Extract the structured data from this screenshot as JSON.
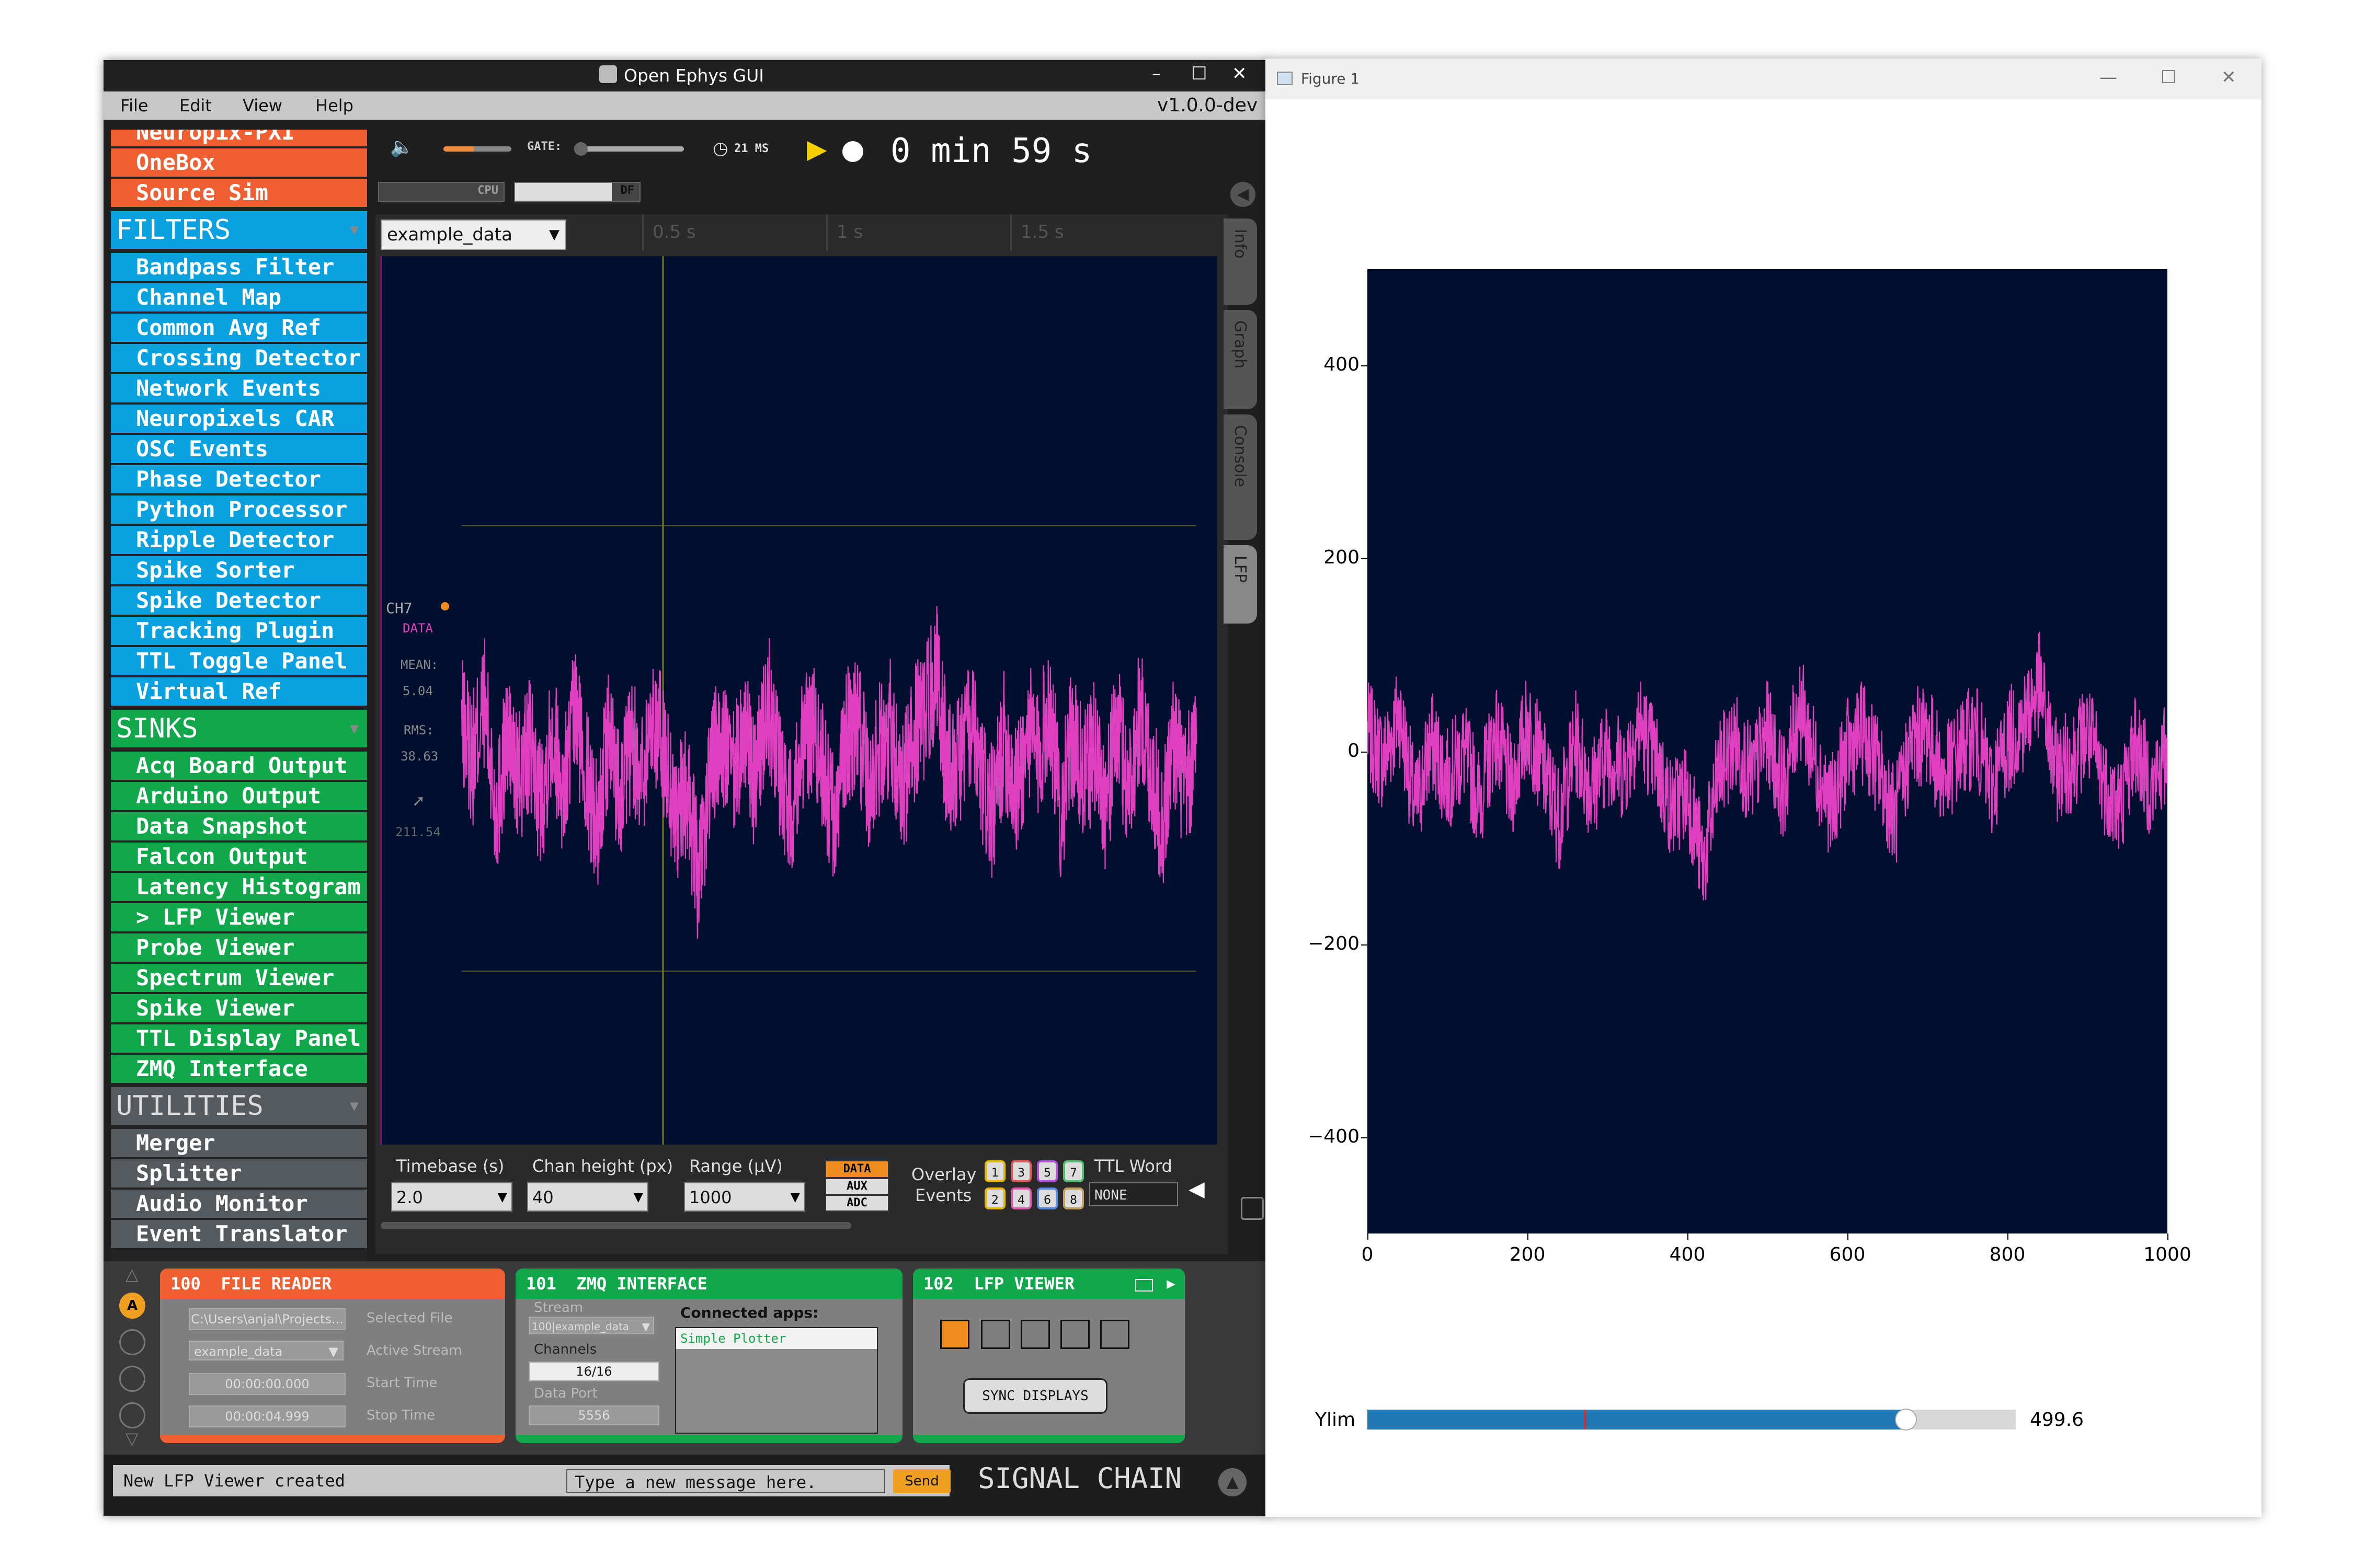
{
  "oe_window": {
    "title": "Open Ephys GUI",
    "version": "v1.0.0-dev",
    "menu": [
      "File",
      "Edit",
      "View",
      "Help"
    ],
    "window_buttons": {
      "minimize": "–",
      "maximize": "☐",
      "close": "✕"
    }
  },
  "processor_list": {
    "sources": [
      "Neuropix-PXI",
      "OneBox",
      "Source Sim"
    ],
    "filters_header": "FILTERS",
    "filters": [
      "Bandpass Filter",
      "Channel Map",
      "Common Avg Ref",
      "Crossing Detector",
      "Network Events",
      "Neuropixels CAR",
      "OSC Events",
      "Phase Detector",
      "Python Processor",
      "Ripple Detector",
      "Spike Sorter",
      "Spike Detector",
      "Tracking Plugin",
      "TTL Toggle Panel",
      "Virtual Ref"
    ],
    "sinks_header": "SINKS",
    "sinks": [
      "Acq Board Output",
      "Arduino Output",
      "Data Snapshot",
      "Falcon Output",
      "Latency Histogram",
      "> LFP Viewer",
      "Probe Viewer",
      "Spectrum Viewer",
      "Spike Viewer",
      "TTL Display Panel",
      "ZMQ Interface"
    ],
    "utilities_header": "UTILITIES",
    "utilities": [
      "Merger",
      "Splitter",
      "Audio Monitor",
      "Event Translator"
    ],
    "header_arrow": "▼"
  },
  "control_bar": {
    "volume_icon": "speaker-icon",
    "volume_level": 0.45,
    "gate_label": "GATE:",
    "gate_level": 0.05,
    "latency": "21 MS",
    "clock_time": "0 min 59 s",
    "cpu_label": "CPU",
    "df_label": "DF",
    "collapse_arrow": "◀"
  },
  "lfp_viewer": {
    "stream_select": "example_data",
    "time_ticks": [
      "0.5 s",
      "1 s",
      "1.5 s"
    ],
    "side_tabs": [
      "Info",
      "Graph",
      "Console",
      "LFP"
    ],
    "channel": {
      "name": "CH7",
      "type": "DATA",
      "mean_label": "MEAN:",
      "mean": "5.04",
      "rms_label": "RMS:",
      "rms": "38.63",
      "extra": "211.54"
    },
    "controls": {
      "timebase_label": "Timebase (s)",
      "timebase": "2.0",
      "chan_height_label": "Chan height (px)",
      "chan_height": "40",
      "range_label": "Range (µV)",
      "range": "1000",
      "data_types": [
        "DATA",
        "AUX",
        "ADC"
      ],
      "overlay_label_1": "Overlay",
      "overlay_label_2": "Events",
      "overlay_buttons": [
        "1",
        "3",
        "5",
        "7",
        "2",
        "4",
        "6",
        "8"
      ],
      "overlay_colors": [
        "#e6b800",
        "#e05a5a",
        "#b450e0",
        "#50c070",
        "#e6b800",
        "#e05ab0",
        "#5a8ae0",
        "#c0a060"
      ],
      "ttl_word_label": "TTL Word",
      "ttl_word": "NONE"
    }
  },
  "signal_chain": {
    "file_reader": {
      "id": "100",
      "name": "FILE READER",
      "file": "C:\\Users\\anjal\\Projects...",
      "file_label": "Selected File",
      "stream": "example_data",
      "stream_label": "Active Stream",
      "start": "00:00:00.000",
      "start_label": "Start Time",
      "stop": "00:00:04.999",
      "stop_label": "Stop Time"
    },
    "zmq": {
      "id": "101",
      "name": "ZMQ INTERFACE",
      "stream_label": "Stream",
      "stream": "100|example_data",
      "channels_label": "Channels",
      "channels": "16/16",
      "port_label": "Data Port",
      "port": "5556",
      "apps_label": "Connected apps:",
      "app": "Simple Plotter"
    },
    "lfp": {
      "id": "102",
      "name": "LFP VIEWER",
      "sync": "SYNC DISPLAYS"
    },
    "side_buttons": [
      "A"
    ],
    "up_arrow": "△",
    "down_arrow": "▽"
  },
  "status_bar": {
    "message": "New LFP Viewer created",
    "input_placeholder": "Type a new message here.",
    "send": "Send",
    "signal_chain_label": "SIGNAL CHAIN"
  },
  "figure_window": {
    "title": "Figure 1",
    "window_buttons": {
      "minimize": "—",
      "maximize": "☐",
      "close": "✕"
    },
    "slider_label": "Ylim",
    "slider_value": "499.6",
    "slider_fraction": 0.83,
    "slider_initial_fraction": 0.335
  },
  "chart_data": {
    "type": "line",
    "xlim": [
      0,
      1000
    ],
    "ylim": [
      -499.6,
      499.6
    ],
    "x_ticks": [
      "0",
      "200",
      "400",
      "600",
      "800",
      "1000"
    ],
    "y_ticks": [
      "400",
      "200",
      "0",
      "−200",
      "−400"
    ],
    "y_tick_values": [
      400,
      200,
      0,
      -200,
      -400
    ],
    "x_tick_values": [
      0,
      200,
      400,
      600,
      800,
      1000
    ],
    "line_color": "#e040c0",
    "background": "#000f2d",
    "series": [
      {
        "points_x": [
          0,
          20,
          40,
          60,
          80,
          100,
          120,
          140,
          160,
          180,
          200,
          220,
          240,
          260,
          280,
          300,
          320,
          340,
          360,
          380,
          400,
          420,
          440,
          460,
          480,
          500,
          520,
          540,
          560,
          580,
          600,
          620,
          640,
          660,
          680,
          700,
          720,
          740,
          760,
          780,
          800,
          820,
          840,
          860,
          880,
          900,
          920,
          940,
          960,
          980,
          1000
        ],
        "points_y": [
          20,
          -10,
          40,
          -60,
          10,
          -30,
          0,
          -50,
          20,
          -40,
          30,
          -20,
          -70,
          10,
          -40,
          0,
          -20,
          30,
          -10,
          -60,
          -40,
          -120,
          -20,
          10,
          -30,
          20,
          -40,
          50,
          -10,
          -60,
          0,
          20,
          -20,
          -70,
          10,
          20,
          -30,
          0,
          20,
          -40,
          10,
          30,
          70,
          -20,
          -10,
          20,
          -30,
          -60,
          10,
          -40,
          0
        ]
      }
    ]
  }
}
